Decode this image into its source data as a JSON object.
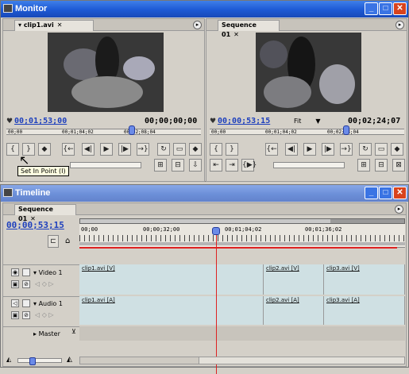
{
  "monitor": {
    "title": "Monitor",
    "source": {
      "tab": "clip1.avi",
      "timecode": "00;01;53;00",
      "duration": "00;00;00;00",
      "ruler": [
        "00;00",
        "00;01;04;02",
        "00;02;08;04"
      ],
      "tooltip": "Set In Point (I)"
    },
    "program": {
      "tab": "Sequence 01",
      "timecode": "00;00;53;15",
      "zoom": "Fit",
      "duration": "00;02;24;07",
      "ruler": [
        "00;00",
        "00;01;04;02",
        "00;02;08;04"
      ]
    }
  },
  "timeline": {
    "title": "Timeline",
    "tab": "Sequence 01",
    "timecode": "00;00;53;15",
    "ruler": [
      "00;00",
      "00;00;32;00",
      "00;01;04;02",
      "00;01;36;02"
    ],
    "tracks": {
      "video": {
        "label": "Video 1",
        "clips": [
          "clip1.avi [V]",
          "clip2.avi [V]",
          "clip3.avi [V]"
        ]
      },
      "audio": {
        "label": "Audio 1",
        "clips": [
          "clip1.avi [A]",
          "clip2.avi [A]",
          "clip3.avi [A]"
        ]
      },
      "master": {
        "label": "Master"
      }
    }
  },
  "icons": {
    "minimize": "minimize-icon",
    "maximize": "maximize-icon",
    "close": "close-icon"
  },
  "colors": {
    "titlebar": "#1d59d4",
    "playhead": "#d22222",
    "clip": "#cfe0e3",
    "timecode": "#1d3fbd"
  }
}
